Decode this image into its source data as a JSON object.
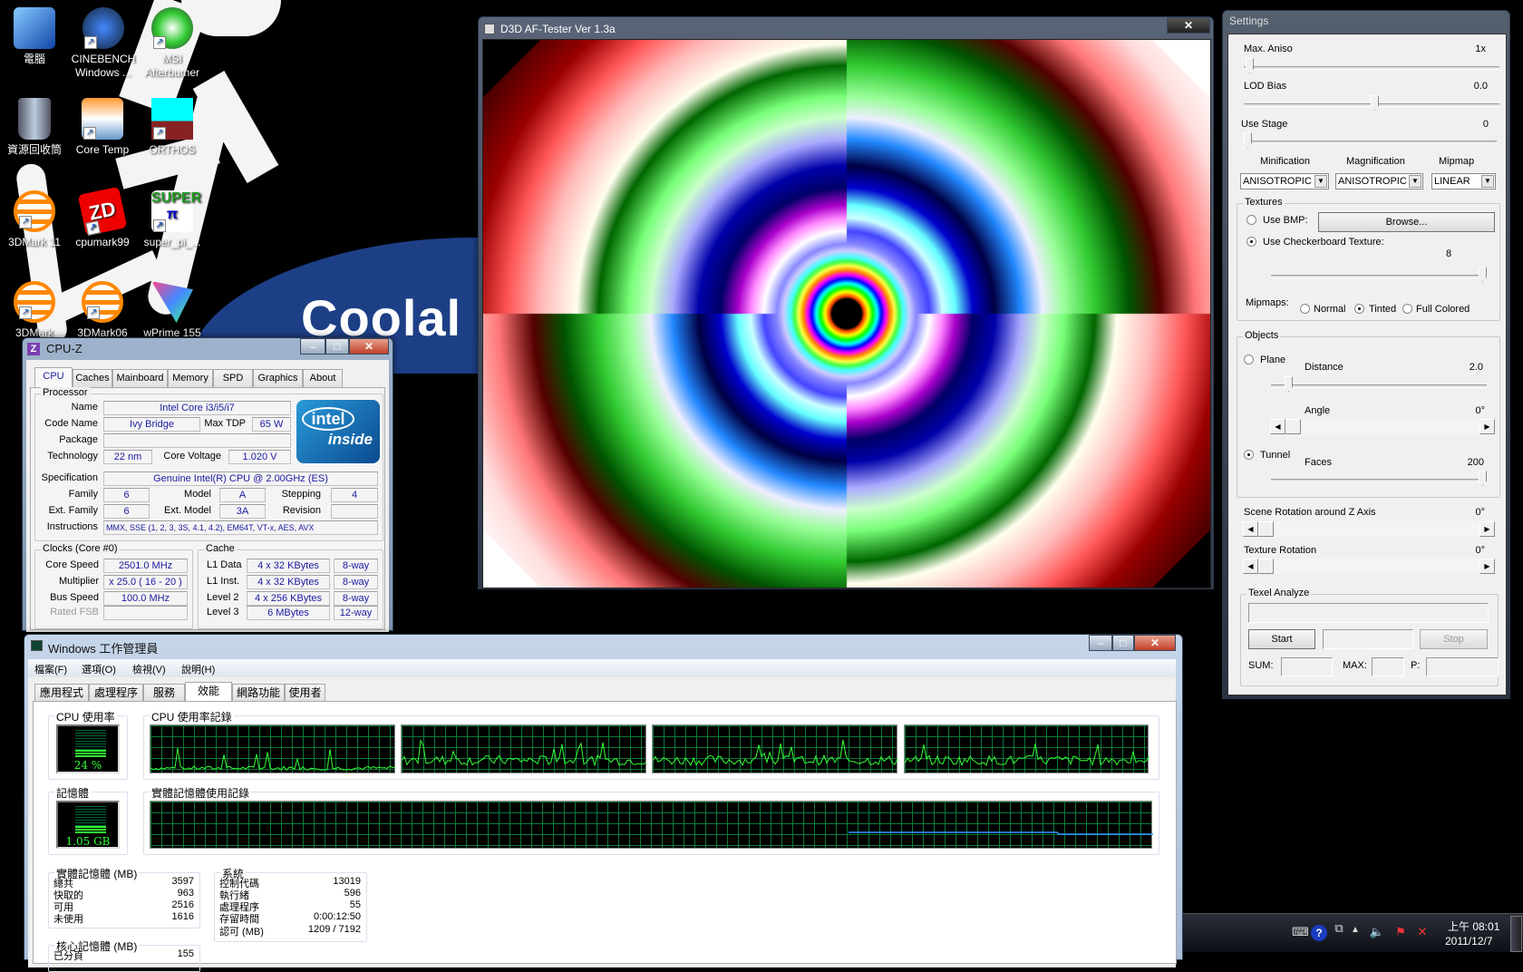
{
  "desktop": {
    "wallpaper_text": "Coolal",
    "icons": [
      {
        "label": "電腦",
        "icon": "computer-icon"
      },
      {
        "label": "CINEBENCH Windows ...",
        "icon": "cinebench-icon"
      },
      {
        "label": "MSI Afterburner",
        "icon": "afterburner-icon"
      },
      {
        "label": "資源回收筒",
        "icon": "recycle-bin-icon"
      },
      {
        "label": "Core Temp",
        "icon": "thermometer-icon"
      },
      {
        "label": "ORTHOS",
        "icon": "orthos-icon"
      },
      {
        "label": "3DMark 11",
        "icon": "3dmark-icon"
      },
      {
        "label": "cpumark99",
        "icon": "zd-icon"
      },
      {
        "label": "super_pi_...",
        "icon": "superpi-icon"
      },
      {
        "label": "3DMark",
        "icon": "3dmark-icon"
      },
      {
        "label": "3DMark06",
        "icon": "3dmark-icon"
      },
      {
        "label": "wPrime 155",
        "icon": "wprime-icon"
      }
    ]
  },
  "d3d": {
    "title": "D3D AF-Tester Ver 1.3a",
    "close": "✕"
  },
  "settings": {
    "title": "Settings",
    "max_aniso": {
      "label": "Max. Aniso",
      "value": "1x",
      "position": 0.0
    },
    "lod_bias": {
      "label": "LOD Bias",
      "value": "0.0",
      "position": 0.5
    },
    "use_stage": {
      "label": "Use Stage",
      "value": "0",
      "position": 0.0
    },
    "filters": [
      {
        "label": "Minification",
        "value": "ANISOTROPIC"
      },
      {
        "label": "Magnification",
        "value": "ANISOTROPIC"
      },
      {
        "label": "Mipmap",
        "value": "LINEAR"
      }
    ],
    "textures": {
      "title": "Textures",
      "use_bmp": "Use BMP:",
      "browse": "Browse...",
      "checker": "Use Checkerboard Texture:",
      "checker_value": "8",
      "mipmaps_label": "Mipmaps:",
      "mipmap_options": [
        "Normal",
        "Tinted",
        "Full Colored"
      ],
      "mipmap_selected": "Tinted"
    },
    "objects": {
      "title": "Objects",
      "plane": "Plane",
      "distance": {
        "label": "Distance",
        "value": "2.0"
      },
      "angle": {
        "label": "Angle",
        "value": "0°"
      },
      "tunnel": "Tunnel",
      "faces": {
        "label": "Faces",
        "value": "200"
      },
      "selected": "Tunnel"
    },
    "scene_rotation": {
      "label": "Scene Rotation around Z Axis",
      "value": "0°"
    },
    "texture_rotation": {
      "label": "Texture Rotation",
      "value": "0°"
    },
    "texel": {
      "title": "Texel Analyze",
      "start": "Start",
      "stop": "Stop",
      "sum": "SUM:",
      "max": "MAX:",
      "p": "P:"
    }
  },
  "cpuz": {
    "title": "CPU-Z",
    "tabs": [
      "CPU",
      "Caches",
      "Mainboard",
      "Memory",
      "SPD",
      "Graphics",
      "About"
    ],
    "active_tab": "CPU",
    "processor": {
      "title": "Processor",
      "name_label": "Name",
      "name": "Intel Core i3/i5/i7",
      "code_label": "Code Name",
      "code": "Ivy Bridge",
      "tdp_label": "Max TDP",
      "tdp": "65 W",
      "package_label": "Package",
      "package": "",
      "tech_label": "Technology",
      "tech": "22 nm",
      "voltage_label": "Core Voltage",
      "voltage": "1.020 V",
      "spec_label": "Specification",
      "spec": "Genuine Intel(R) CPU  @ 2.00GHz (ES)",
      "family_label": "Family",
      "family": "6",
      "model_label": "Model",
      "model": "A",
      "stepping_label": "Stepping",
      "stepping": "4",
      "extfamily_label": "Ext. Family",
      "extfamily": "6",
      "extmodel_label": "Ext. Model",
      "extmodel": "3A",
      "revision_label": "Revision",
      "revision": "",
      "instr_label": "Instructions",
      "instr": "MMX, SSE (1, 2, 3, 3S, 4.1, 4.2), EM64T, VT-x, AES, AVX",
      "logo_top": "intel",
      "logo_bottom": "inside"
    },
    "clocks": {
      "title": "Clocks (Core #0)",
      "core_label": "Core Speed",
      "core": "2501.0 MHz",
      "mult_label": "Multiplier",
      "mult": "x 25.0 ( 16 - 20 )",
      "bus_label": "Bus Speed",
      "bus": "100.0 MHz",
      "fsb_label": "Rated FSB",
      "fsb": ""
    },
    "cache": {
      "title": "Cache",
      "rows": [
        {
          "label": "L1 Data",
          "size": "4 x 32 KBytes",
          "way": "8-way"
        },
        {
          "label": "L1 Inst.",
          "size": "4 x 32 KBytes",
          "way": "8-way"
        },
        {
          "label": "Level 2",
          "size": "4 x 256 KBytes",
          "way": "8-way"
        },
        {
          "label": "Level 3",
          "size": "6 MBytes",
          "way": "12-way"
        }
      ]
    }
  },
  "taskmgr": {
    "title": "Windows 工作管理員",
    "menu": [
      "檔案(F)",
      "選項(O)",
      "檢視(V)",
      "說明(H)"
    ],
    "tabs": [
      "應用程式",
      "處理程序",
      "服務",
      "效能",
      "網路功能",
      "使用者"
    ],
    "active_tab": "效能",
    "cpu_usage_title": "CPU 使用率",
    "cpu_usage": "24 %",
    "cpu_history_title": "CPU 使用率記錄",
    "mem_title": "記憶體",
    "mem_usage": "1.05 GB",
    "mem_history_title": "實體記憶體使用記錄",
    "physical": {
      "title": "實體記憶體 (MB)",
      "rows": [
        {
          "label": "總共",
          "value": "3597"
        },
        {
          "label": "快取的",
          "value": "963"
        },
        {
          "label": "可用",
          "value": "2516"
        },
        {
          "label": "未使用",
          "value": "1616"
        }
      ]
    },
    "system": {
      "title": "系統",
      "rows": [
        {
          "label": "控制代碼",
          "value": "13019"
        },
        {
          "label": "執行緒",
          "value": "596"
        },
        {
          "label": "處理程序",
          "value": "55"
        },
        {
          "label": "存留時間",
          "value": "0:00:12:50"
        },
        {
          "label": "認可 (MB)",
          "value": "1209 / 7192"
        }
      ]
    },
    "kernel": {
      "title": "核心記憶體 (MB)",
      "rows": [
        {
          "label": "已分頁",
          "value": "155"
        }
      ]
    }
  },
  "taskbar": {
    "time": "上午 08:01",
    "date": "2011/12/7"
  }
}
